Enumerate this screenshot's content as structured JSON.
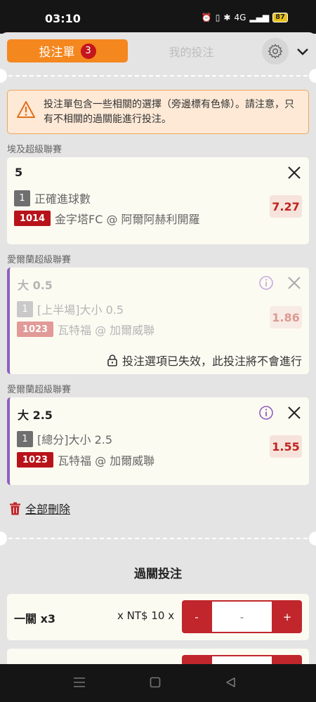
{
  "status_bar": {
    "time": "03:10",
    "network": "4G",
    "battery": "87"
  },
  "tabs": {
    "betslip_label": "投注單",
    "betslip_count": "3",
    "my_bets_label": "我的投注"
  },
  "warning": {
    "text": "投注單包含一些相關的選擇（旁邊標有色條）。請注意，只有不相關的過關能進行投注。"
  },
  "selections": [
    {
      "league": "埃及超級聯賽",
      "title": "5",
      "leg": "1",
      "market": "正確進球數",
      "match_no": "1014",
      "match": "金字塔FC @ 阿爾阿赫利開羅",
      "odds": "7.27"
    },
    {
      "league": "愛爾蘭超級聯賽",
      "title": "大 0.5",
      "leg": "1",
      "market": "[上半場]大小 0.5",
      "match_no": "1023",
      "match": "瓦特福 @ 加爾威聯",
      "odds": "1.86",
      "expired_text": "投注選項已失效，此投注將不會進行"
    },
    {
      "league": "愛爾蘭超級聯賽",
      "title": "大 2.5",
      "leg": "1",
      "market": "[總分]大小 2.5",
      "match_no": "1023",
      "match": "瓦特福 @ 加爾威聯",
      "odds": "1.55"
    }
  ],
  "delete_all_label": "全部刪除",
  "combo": {
    "title": "過關投注",
    "rows": [
      {
        "name": "一關 x3",
        "stake": "x NT$ 10 x",
        "minus": "-",
        "value": "-",
        "plus": "+"
      }
    ]
  },
  "colors": {
    "accent": "#f5871f",
    "badge": "#c4161c",
    "odds_text": "#c0231f",
    "related_bar": "#8d5fc0"
  }
}
